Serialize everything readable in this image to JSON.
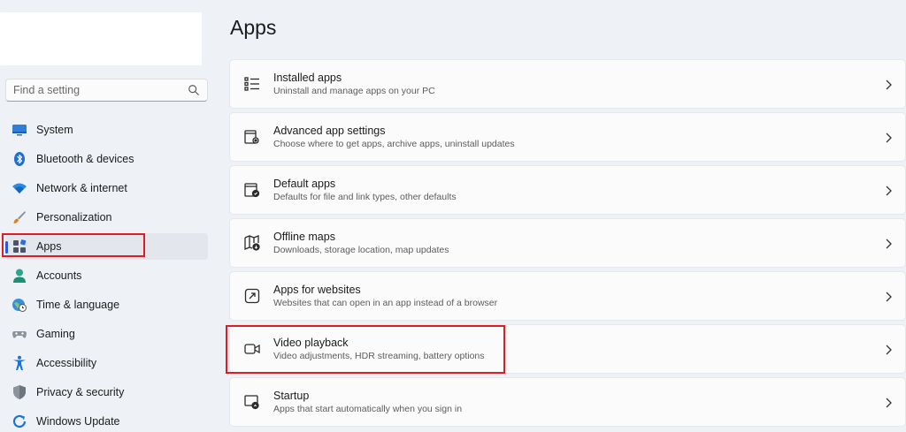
{
  "search": {
    "placeholder": "Find a setting"
  },
  "sidebar": {
    "items": [
      {
        "label": "System",
        "icon": "system-icon"
      },
      {
        "label": "Bluetooth & devices",
        "icon": "bluetooth-icon"
      },
      {
        "label": "Network & internet",
        "icon": "wifi-icon"
      },
      {
        "label": "Personalization",
        "icon": "brush-icon"
      },
      {
        "label": "Apps",
        "icon": "apps-icon",
        "selected": true
      },
      {
        "label": "Accounts",
        "icon": "person-icon"
      },
      {
        "label": "Time & language",
        "icon": "globe-clock-icon"
      },
      {
        "label": "Gaming",
        "icon": "gamepad-icon"
      },
      {
        "label": "Accessibility",
        "icon": "accessibility-icon"
      },
      {
        "label": "Privacy & security",
        "icon": "shield-icon"
      },
      {
        "label": "Windows Update",
        "icon": "update-icon"
      }
    ]
  },
  "main": {
    "title": "Apps",
    "cards": [
      {
        "title": "Installed apps",
        "desc": "Uninstall and manage apps on your PC",
        "icon": "list-icon"
      },
      {
        "title": "Advanced app settings",
        "desc": "Choose where to get apps, archive apps, uninstall updates",
        "icon": "app-settings-icon"
      },
      {
        "title": "Default apps",
        "desc": "Defaults for file and link types, other defaults",
        "icon": "default-apps-icon"
      },
      {
        "title": "Offline maps",
        "desc": "Downloads, storage location, map updates",
        "icon": "map-icon"
      },
      {
        "title": "Apps for websites",
        "desc": "Websites that can open in an app instead of a browser",
        "icon": "open-link-icon"
      },
      {
        "title": "Video playback",
        "desc": "Video adjustments, HDR streaming, battery options",
        "icon": "video-icon"
      },
      {
        "title": "Startup",
        "desc": "Apps that start automatically when you sign in",
        "icon": "startup-icon"
      }
    ]
  },
  "colors": {
    "accent": "#2a5bd7",
    "highlight": "#e01b24",
    "background": "#eef1f6"
  }
}
